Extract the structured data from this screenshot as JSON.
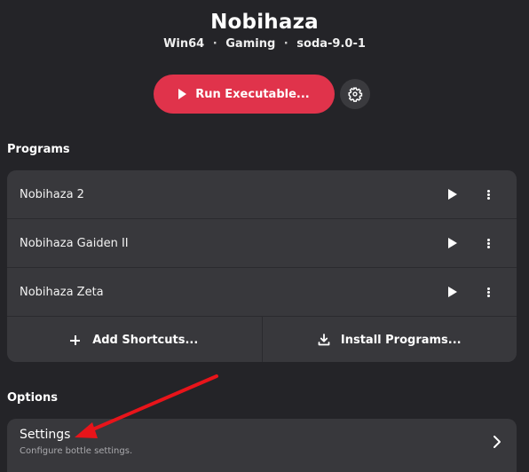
{
  "header": {
    "title": "Nobihaza",
    "meta": [
      "Win64",
      "Gaming",
      "soda-9.0-1"
    ],
    "separator": "·"
  },
  "run_button": {
    "label": "Run Executable..."
  },
  "programs": {
    "section_label": "Programs",
    "items": [
      {
        "name": "Nobihaza 2"
      },
      {
        "name": "Nobihaza Gaiden II"
      },
      {
        "name": "Nobihaza Zeta"
      }
    ],
    "add_shortcuts_label": "Add Shortcuts...",
    "install_programs_label": "Install Programs..."
  },
  "options": {
    "section_label": "Options",
    "settings": {
      "title": "Settings",
      "subtitle": "Configure bottle settings."
    }
  },
  "colors": {
    "background": "#242428",
    "card": "#38383c",
    "accent": "#e0334b",
    "annotation_arrow": "#e8141a"
  },
  "icons": {
    "run": "play-icon",
    "bottle_settings": "gear-icon",
    "program_run": "play-icon",
    "program_menu": "more-vertical-icon",
    "add": "plus-icon",
    "install": "download-icon",
    "settings_open": "chevron-right-icon"
  }
}
